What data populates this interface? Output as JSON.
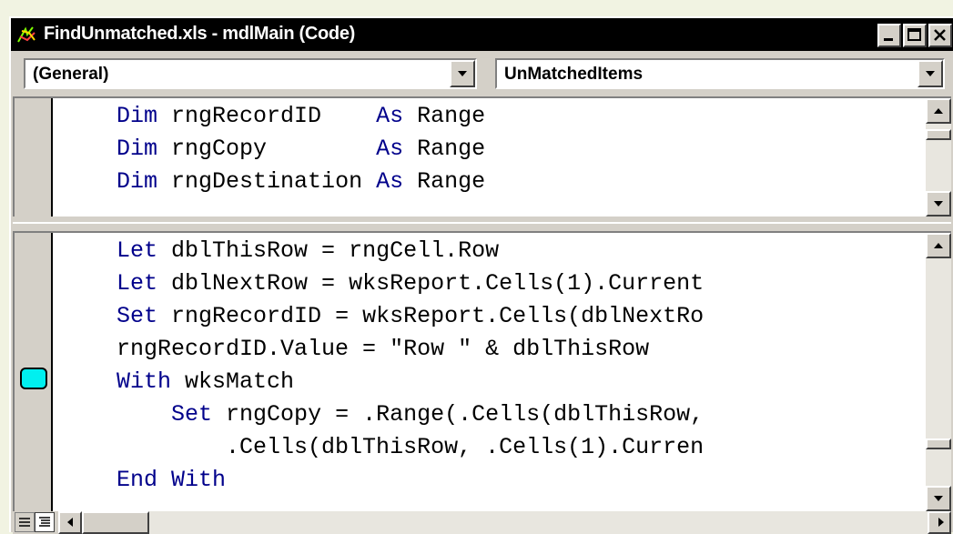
{
  "window": {
    "title": "FindUnmatched.xls - mdlMain (Code)"
  },
  "toolbar": {
    "object_combo": "(General)",
    "procedure_combo": "UnMatchedItems"
  },
  "declarations_pane": {
    "lines": [
      [
        {
          "t": "Dim",
          "kw": true
        },
        {
          "t": " rngRecordID    ",
          "kw": false
        },
        {
          "t": "As",
          "kw": true
        },
        {
          "t": " Range",
          "kw": false
        }
      ],
      [
        {
          "t": "Dim",
          "kw": true
        },
        {
          "t": " rngCopy        ",
          "kw": false
        },
        {
          "t": "As",
          "kw": true
        },
        {
          "t": " Range",
          "kw": false
        }
      ],
      [
        {
          "t": "Dim",
          "kw": true
        },
        {
          "t": " rngDestination ",
          "kw": false
        },
        {
          "t": "As",
          "kw": true
        },
        {
          "t": " Range",
          "kw": false
        }
      ]
    ]
  },
  "code_pane": {
    "lines": [
      [
        {
          "t": "Let",
          "kw": true
        },
        {
          "t": " dblThisRow = rngCell.Row",
          "kw": false
        }
      ],
      [
        {
          "t": "Let",
          "kw": true
        },
        {
          "t": " dblNextRow = wksReport.Cells(1).Current",
          "kw": false
        }
      ],
      [
        {
          "t": "Set",
          "kw": true
        },
        {
          "t": " rngRecordID = wksReport.Cells(dblNextRo",
          "kw": false
        }
      ],
      [
        {
          "t": "rngRecordID.Value = \"Row \" & dblThisRow",
          "kw": false
        }
      ],
      [
        {
          "t": "With",
          "kw": true
        },
        {
          "t": " wksMatch",
          "kw": false
        }
      ],
      [
        {
          "t": "    ",
          "kw": false
        },
        {
          "t": "Set",
          "kw": true
        },
        {
          "t": " rngCopy = .Range(.Cells(dblThisRow,",
          "kw": false
        }
      ],
      [
        {
          "t": "        .Cells(dblThisRow, .Cells(1).Curren",
          "kw": false
        }
      ],
      [
        {
          "t": "End With",
          "kw": true
        }
      ]
    ]
  },
  "colors": {
    "keyword": "#00008b",
    "bookmark": "#00f0f0",
    "titlebar": "#000000"
  },
  "icons": {
    "app": "vba-code-icon",
    "minimize": "minimize-icon",
    "maximize": "maximize-icon",
    "close": "close-icon"
  }
}
